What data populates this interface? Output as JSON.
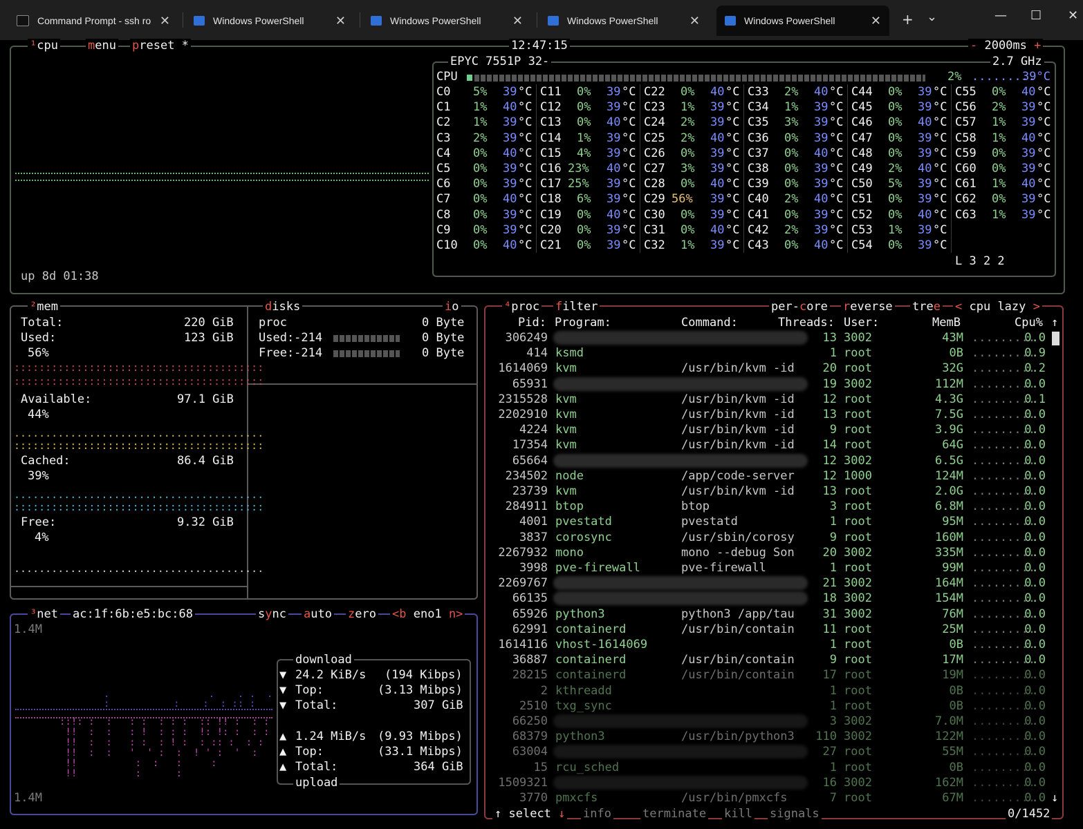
{
  "window": {
    "tabs": [
      {
        "title": "Command Prompt - ssh  ro",
        "icon": "cmd-icon"
      },
      {
        "title": "Windows PowerShell",
        "icon": "powershell-icon"
      },
      {
        "title": "Windows PowerShell",
        "icon": "powershell-icon"
      },
      {
        "title": "Windows PowerShell",
        "icon": "powershell-icon"
      },
      {
        "title": "Windows PowerShell",
        "icon": "powershell-icon"
      }
    ],
    "close": "✕",
    "new_tab": "+",
    "dropdown": "⌄",
    "minimize": "—",
    "maximize": "☐",
    "win_close": "✕"
  },
  "cpu": {
    "title": "cpu",
    "num": "¹",
    "menu": "menu",
    "preset": "preset *",
    "clock": "12:47:15",
    "interval": "2000ms",
    "minus": "-",
    "plus": "+",
    "model": "EPYC 7551P 32-",
    "freq": "2.7 GHz",
    "total_label": "CPU",
    "total_pct": "2%",
    "total_temp": "39°C",
    "uptime": "up 8d 01:38",
    "load": "L 3 2 2",
    "cores": [
      [
        "C0",
        "5%",
        "39°C"
      ],
      [
        "C1",
        "1%",
        "40°C"
      ],
      [
        "C2",
        "1%",
        "39°C"
      ],
      [
        "C3",
        "2%",
        "39°C"
      ],
      [
        "C4",
        "0%",
        "40°C"
      ],
      [
        "C5",
        "0%",
        "39°C"
      ],
      [
        "C6",
        "0%",
        "39°C"
      ],
      [
        "C7",
        "0%",
        "40°C"
      ],
      [
        "C8",
        "0%",
        "39°C"
      ],
      [
        "C9",
        "0%",
        "39°C"
      ],
      [
        "C10",
        "0%",
        "40°C"
      ],
      [
        "C11",
        "0%",
        "39°C"
      ],
      [
        "C12",
        "0%",
        "39°C"
      ],
      [
        "C13",
        "0%",
        "40°C"
      ],
      [
        "C14",
        "1%",
        "39°C"
      ],
      [
        "C15",
        "4%",
        "39°C"
      ],
      [
        "C16",
        "23%",
        "40°C"
      ],
      [
        "C17",
        "25%",
        "39°C"
      ],
      [
        "C18",
        "6%",
        "39°C"
      ],
      [
        "C19",
        "0%",
        "40°C"
      ],
      [
        "C20",
        "0%",
        "39°C"
      ],
      [
        "C21",
        "0%",
        "39°C"
      ],
      [
        "C22",
        "0%",
        "40°C"
      ],
      [
        "C23",
        "1%",
        "39°C"
      ],
      [
        "C24",
        "2%",
        "39°C"
      ],
      [
        "C25",
        "2%",
        "40°C"
      ],
      [
        "C26",
        "0%",
        "39°C"
      ],
      [
        "C27",
        "3%",
        "39°C"
      ],
      [
        "C28",
        "0%",
        "40°C"
      ],
      [
        "C29",
        "56%",
        "39°C"
      ],
      [
        "C30",
        "0%",
        "39°C"
      ],
      [
        "C31",
        "0%",
        "40°C"
      ],
      [
        "C32",
        "1%",
        "39°C"
      ],
      [
        "C33",
        "2%",
        "40°C"
      ],
      [
        "C34",
        "1%",
        "39°C"
      ],
      [
        "C35",
        "3%",
        "39°C"
      ],
      [
        "C36",
        "0%",
        "39°C"
      ],
      [
        "C37",
        "0%",
        "40°C"
      ],
      [
        "C38",
        "0%",
        "39°C"
      ],
      [
        "C39",
        "0%",
        "39°C"
      ],
      [
        "C40",
        "2%",
        "40°C"
      ],
      [
        "C41",
        "0%",
        "39°C"
      ],
      [
        "C42",
        "2%",
        "39°C"
      ],
      [
        "C43",
        "0%",
        "40°C"
      ],
      [
        "C44",
        "0%",
        "39°C"
      ],
      [
        "C45",
        "0%",
        "39°C"
      ],
      [
        "C46",
        "0%",
        "40°C"
      ],
      [
        "C47",
        "0%",
        "39°C"
      ],
      [
        "C48",
        "0%",
        "39°C"
      ],
      [
        "C49",
        "2%",
        "40°C"
      ],
      [
        "C50",
        "5%",
        "39°C"
      ],
      [
        "C51",
        "0%",
        "39°C"
      ],
      [
        "C52",
        "0%",
        "40°C"
      ],
      [
        "C53",
        "1%",
        "39°C"
      ],
      [
        "C54",
        "0%",
        "39°C"
      ],
      [
        "C55",
        "0%",
        "40°C"
      ],
      [
        "C56",
        "2%",
        "39°C"
      ],
      [
        "C57",
        "1%",
        "39°C"
      ],
      [
        "C58",
        "1%",
        "40°C"
      ],
      [
        "C59",
        "0%",
        "39°C"
      ],
      [
        "C60",
        "0%",
        "39°C"
      ],
      [
        "C61",
        "1%",
        "40°C"
      ],
      [
        "C62",
        "0%",
        "39°C"
      ],
      [
        "C63",
        "1%",
        "39°C"
      ]
    ]
  },
  "mem": {
    "title": "mem",
    "num": "²",
    "total_label": "Total:",
    "total": "220 GiB",
    "used_label": "Used:",
    "used": "123 GiB",
    "used_pct": "56%",
    "avail_label": "Available:",
    "avail": "97.1 GiB",
    "avail_pct": "44%",
    "cached_label": "Cached:",
    "cached": "86.4 GiB",
    "cached_pct": "39%",
    "free_label": "Free:",
    "free": "9.32 GiB",
    "free_pct": "4%"
  },
  "disks": {
    "title": "disks",
    "io": "io",
    "proc": "proc",
    "proc_val": "0 Byte",
    "used": "Used:-214",
    "used_val": "0 Byte",
    "free": "Free:-214",
    "free_val": "0 Byte"
  },
  "net": {
    "title": "net",
    "num": "³",
    "iface_mac": "ac:1f:6b:e5:bc:68",
    "sync": "sync",
    "auto": "auto",
    "zero": "zero",
    "prev": "<b",
    "iface": "eno1",
    "next": "n>",
    "scale_top": "1.4M",
    "scale_bot": "1.4M",
    "download": "download",
    "dl_rate": "24.2 KiB/s",
    "dl_bps": "(194 Kibps)",
    "dl_top_label": "Top:",
    "dl_top": "(3.13 Mibps)",
    "dl_total_label": "Total:",
    "dl_total": "307 GiB",
    "ul_rate": "1.24 MiB/s",
    "ul_bps": "(9.93 Mibps)",
    "ul_top_label": "Top:",
    "ul_top": "(33.1 Mibps)",
    "ul_total_label": "Total:",
    "ul_total": "364 GiB",
    "upload": "upload"
  },
  "proc": {
    "title": "proc",
    "num": "⁴",
    "filter": "filter",
    "per_core": "per-core",
    "reverse": "reverse",
    "tree": "tree",
    "sort_prev": "<",
    "sort": "cpu lazy",
    "sort_next": ">",
    "headers": {
      "pid": "Pid:",
      "program": "Program:",
      "command": "Command:",
      "threads": "Threads:",
      "user": "User:",
      "memb": "MemB",
      "cpu": "Cpu%"
    },
    "rows": [
      [
        "306249",
        "",
        "",
        "13",
        "3002",
        "43M",
        "0.0"
      ],
      [
        "414",
        "ksmd",
        "",
        "1",
        "root",
        "0B",
        "0.9"
      ],
      [
        "1614069",
        "kvm",
        "/usr/bin/kvm -id",
        "20",
        "root",
        "32G",
        "0.2"
      ],
      [
        "65931",
        "",
        "",
        "19",
        "3002",
        "112M",
        "0.0"
      ],
      [
        "2315528",
        "kvm",
        "/usr/bin/kvm -id",
        "12",
        "root",
        "4.3G",
        "0.1"
      ],
      [
        "2202910",
        "kvm",
        "/usr/bin/kvm -id",
        "13",
        "root",
        "7.5G",
        "0.0"
      ],
      [
        "4224",
        "kvm",
        "/usr/bin/kvm -id",
        "9",
        "root",
        "3.9G",
        "0.0"
      ],
      [
        "17354",
        "kvm",
        "/usr/bin/kvm -id",
        "14",
        "root",
        "64G",
        "0.0"
      ],
      [
        "65664",
        "",
        "",
        "12",
        "3002",
        "6.5G",
        "0.0"
      ],
      [
        "234502",
        "node",
        "/app/code-server",
        "12",
        "1000",
        "124M",
        "0.0"
      ],
      [
        "23739",
        "kvm",
        "/usr/bin/kvm -id",
        "13",
        "root",
        "2.0G",
        "0.0"
      ],
      [
        "284911",
        "btop",
        "btop",
        "3",
        "root",
        "6.8M",
        "0.0"
      ],
      [
        "4001",
        "pvestatd",
        "pvestatd",
        "1",
        "root",
        "95M",
        "0.0"
      ],
      [
        "3837",
        "corosync",
        "/usr/sbin/corosy",
        "9",
        "root",
        "160M",
        "0.0"
      ],
      [
        "2267932",
        "mono",
        "mono --debug Son",
        "20",
        "3002",
        "335M",
        "0.0"
      ],
      [
        "3998",
        "pve-firewall",
        "pve-firewall",
        "1",
        "root",
        "99M",
        "0.0"
      ],
      [
        "2269767",
        "",
        "",
        "21",
        "3002",
        "164M",
        "0.0"
      ],
      [
        "66135",
        "",
        "",
        "18",
        "3002",
        "154M",
        "0.0"
      ],
      [
        "65926",
        "python3",
        "python3 /app/tau",
        "31",
        "3002",
        "76M",
        "0.0"
      ],
      [
        "62991",
        "containerd",
        "/usr/bin/contain",
        "11",
        "root",
        "25M",
        "0.0"
      ],
      [
        "1614116",
        "vhost-1614069",
        "",
        "1",
        "root",
        "0B",
        "0.0"
      ],
      [
        "36887",
        "containerd",
        "/usr/bin/contain",
        "9",
        "root",
        "17M",
        "0.0"
      ],
      [
        "28215",
        "containerd",
        "/usr/bin/contain",
        "17",
        "root",
        "19M",
        "0.0"
      ],
      [
        "2",
        "kthreadd",
        "",
        "1",
        "root",
        "0B",
        "0.0"
      ],
      [
        "2510",
        "txg_sync",
        "",
        "1",
        "root",
        "0B",
        "0.0"
      ],
      [
        "66250",
        "",
        "",
        "3",
        "3002",
        "7.0M",
        "0.0"
      ],
      [
        "68379",
        "python3",
        "/usr/bin/python3",
        "110",
        "3002",
        "122M",
        "0.0"
      ],
      [
        "63004",
        "",
        "",
        "27",
        "root",
        "55M",
        "0.0"
      ],
      [
        "15",
        "rcu_sched",
        "",
        "1",
        "root",
        "0B",
        "0.0"
      ],
      [
        "1509321",
        "",
        "",
        "16",
        "3002",
        "162M",
        "0.0"
      ],
      [
        "3770",
        "pmxcfs",
        "/usr/bin/pmxcfs",
        "7",
        "root",
        "67M",
        "0.0"
      ]
    ],
    "footer": {
      "up": "↑",
      "select": "select",
      "down": "↓",
      "info": "info",
      "terminate": "terminate",
      "kill": "kill",
      "signals": "signals",
      "count": "0/1452"
    }
  }
}
